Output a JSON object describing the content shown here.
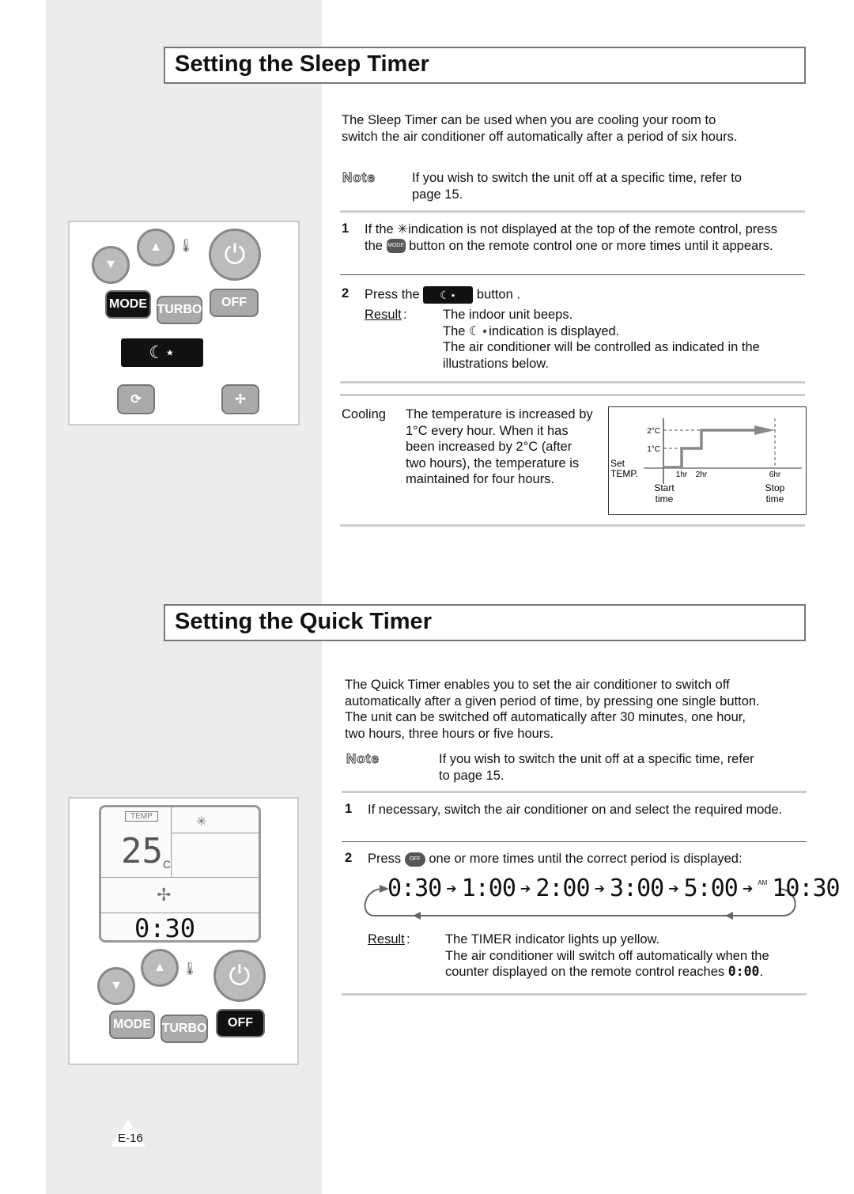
{
  "sleep": {
    "title": "Setting the Sleep Timer",
    "intro": "The Sleep Timer can be used when you are cooling your room to switch the air conditioner off automatically after a period of six hours.",
    "note_label": "Note",
    "note": "If you wish to switch the unit off at a specific time, refer to page 15.",
    "step1_num": "1",
    "step1_a": "If the",
    "step1_b": "indication is not displayed at the top of the remote control, press the",
    "step1_c": "button on the remote control one or more times until it appears.",
    "step2_num": "2",
    "step2_a": "Press the",
    "step2_b": "button .",
    "result_label": "Result",
    "result_1": "The indoor unit beeps.",
    "result_2a": "The",
    "result_2b": "indication is displayed.",
    "result_3": "The air conditioner will be controlled as indicated in the illustrations below.",
    "cooling_label": "Cooling",
    "cooling_text": "The temperature is increased by 1°C every hour. When it has been increased by 2°C (after two hours), the temperature is maintained for four hours.",
    "diagram": {
      "y_labels": [
        "2°C",
        "1°C"
      ],
      "set_label": "Set",
      "temp_label": "TEMP.",
      "x_labels": [
        "1hr",
        "2hr",
        "6hr"
      ],
      "start": "Start",
      "start2": "time",
      "stop": "Stop",
      "stop2": "time"
    },
    "remote": {
      "mode": "MODE",
      "turbo": "TURBO",
      "off": "OFF"
    }
  },
  "quick": {
    "title": "Setting the Quick Timer",
    "intro": "The Quick Timer enables you to set the air conditioner to switch off automatically after a given period of time, by pressing one single button. The unit can be switched off automatically after 30 minutes, one hour, two hours, three hours or five hours.",
    "note_label": "Note",
    "note": "If you wish to switch the unit off at a specific time, refer to page 15.",
    "step1_num": "1",
    "step1": "If necessary, switch the air conditioner on and select the required mode.",
    "step2_num": "2",
    "step2_a": "Press",
    "step2_b": "one or more times until the correct period is displayed:",
    "sequence": [
      "0:30",
      "1:00",
      "2:00",
      "3:00",
      "5:00"
    ],
    "am_label": "AM",
    "current_time": "10:30",
    "result_label": "Result",
    "result_1": "The TIMER indicator lights up yellow.",
    "result_2": "The air conditioner will switch off automatically when the counter displayed on the remote control reaches",
    "result_end": "0:00",
    "remote": {
      "temp_label": "TEMP",
      "temp_value": "25",
      "unit": "C",
      "timer_value": "0:30",
      "mode": "MODE",
      "turbo": "TURBO",
      "off": "OFF"
    }
  },
  "footer": {
    "page": "E-16"
  }
}
